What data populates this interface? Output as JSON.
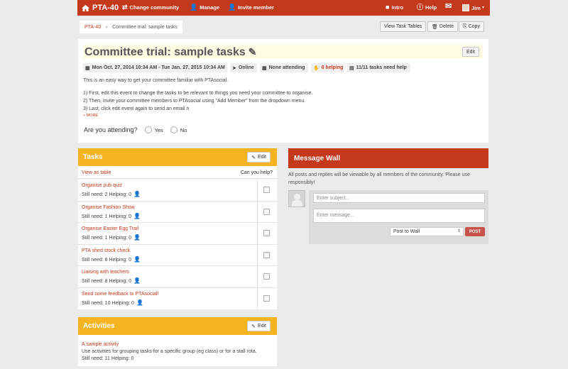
{
  "nav": {
    "brand": "PTA-40",
    "change_community": "Change community",
    "manage": "Manage",
    "invite_member": "Invite member",
    "intro": "Intro",
    "help": "Help",
    "user": "Jim"
  },
  "breadcrumb": {
    "root": "PTA-40",
    "separator": "»",
    "current": "Committee trial: sample tasks"
  },
  "toolbar": {
    "view_task_tables": "View Task Tables",
    "delete": "Delete",
    "copy": "Copy"
  },
  "event": {
    "title": "Committee trial: sample tasks",
    "edit_label": "Edit",
    "dates": "Mon Oct. 27, 2014 10:34 AM - Tue Jan. 27, 2015 10:34 AM",
    "location": "Online",
    "attending": "None attending",
    "helping": "0 helping",
    "tasks_need_help": "11/11 tasks need help",
    "description": [
      "This is an easy way to get your committee familiar with PTAsocial.",
      "1) First, edit this event to change the tasks to be relevant to things you need your committee to organise.",
      "2) Then, invite your committee members to PTAsocial using \"Add Member\" from the dropdown menu.",
      "3) Last, click edit event again to send an email n"
    ],
    "more": "» MORE",
    "attend_question": "Are you attending?",
    "yes": "Yes",
    "no": "No"
  },
  "tasks": {
    "title": "Tasks",
    "edit_label": "Edit",
    "view_as_table": "View as table",
    "can_you_help": "Can you help?",
    "items": [
      {
        "name": "Organise pub quiz",
        "status": "Still need: 2 Helping: 0"
      },
      {
        "name": "Organise Fashion Show",
        "status": "Still need: 1 Helping: 0"
      },
      {
        "name": "Organise Easter Egg Trail",
        "status": "Still need: 1 Helping: 0"
      },
      {
        "name": "PTA shed stock check",
        "status": "Still need: 6 Helping: 0"
      },
      {
        "name": "Liaising with teachers",
        "status": "Still need: 8 Helping: 0"
      },
      {
        "name": "Send some feedback to PTAsocial!",
        "status": "Still need: 10 Helping: 0"
      }
    ]
  },
  "activities": {
    "title": "Activities",
    "edit_label": "Edit",
    "item_name": "A sample activity",
    "item_desc": "Use activities for grouping tasks for a specific group (eg class) or for a stall rota.",
    "item_status": "Still need: 11  Helping: 0"
  },
  "wall": {
    "title": "Message Wall",
    "note": "All posts and replies will be viewable by all members of the community. Please use responsibly!",
    "subject_placeholder": "Enter subject...",
    "message_placeholder": "Enter message...",
    "post_to": "Post to Wall",
    "post_button": "POST"
  },
  "colors": {
    "brand_red": "#c4381b",
    "tasks_yellow": "#f6b421",
    "link_red": "#c4381b"
  }
}
